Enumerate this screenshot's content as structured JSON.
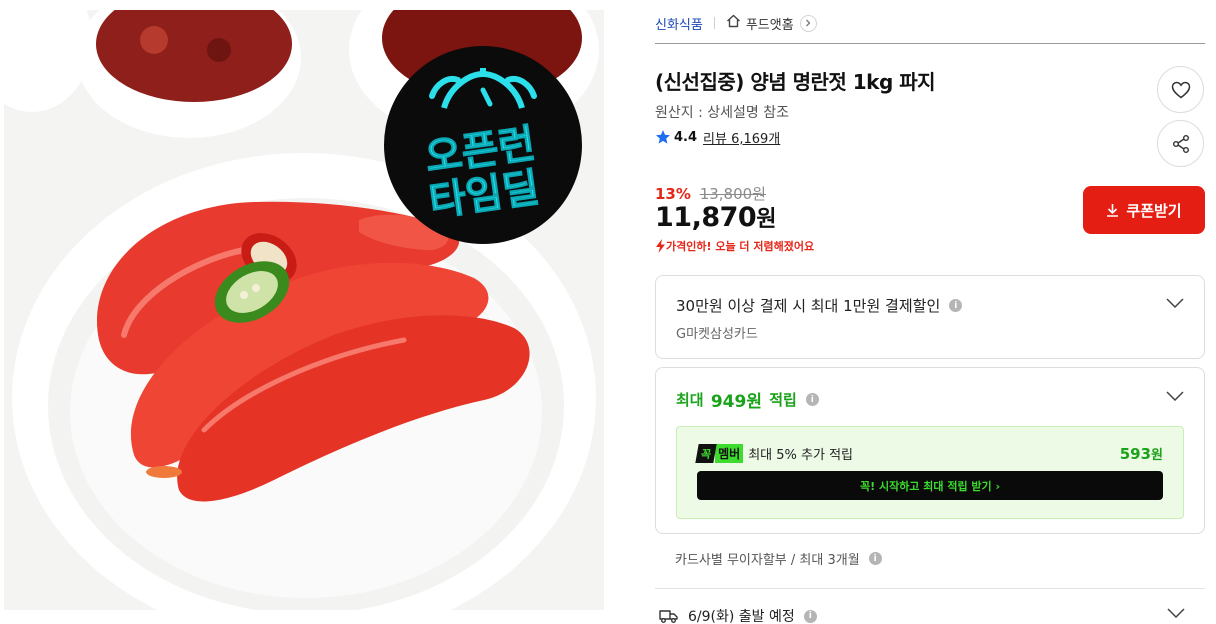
{
  "seller": {
    "name": "신화식품",
    "brand": "푸드앳홈"
  },
  "badge": {
    "line1": "오픈런",
    "line2": "타임딜"
  },
  "product": {
    "title": "(신선집중) 양념 명란젓 1kg 파지",
    "origin": "원산지 : 상세설명 참조",
    "rating": "4.4",
    "review_label": "리뷰 6,169개"
  },
  "price": {
    "discount_rate": "13%",
    "original": "13,800원",
    "sale_number": "11,870",
    "sale_unit": "원",
    "notice": "가격인하! 오늘 더 저렴해졌어요"
  },
  "coupon_button": "쿠폰받기",
  "card_benefit": {
    "title": "30만원 이상 결제 시 최대 1만원 결제할인",
    "subtitle": "G마켓삼성카드"
  },
  "reward": {
    "prefix": "최대",
    "amount": "949원",
    "suffix": "적립",
    "member_logo_a": "꼭",
    "member_logo_b": "멤버",
    "member_text": "최대 5% 추가 적립",
    "member_amount": "593",
    "member_amount_unit": "원",
    "cta": "꼭! 시작하고 최대 적립 받기  ›"
  },
  "installment": "카드사별 무이자할부 / 최대 3개월",
  "shipping": "6/9(화) 출발 예정",
  "icons": [
    "home-icon",
    "chevron-right-icon",
    "star-icon",
    "heart-icon",
    "share-icon",
    "download-icon",
    "bolt-icon",
    "info-icon",
    "chevron-down-icon",
    "truck-icon",
    "alarm-clock-icon"
  ],
  "colors": {
    "accent_red": "#e41e13",
    "reward_green": "#1aa31a",
    "member_green": "#3ddc2f",
    "link_blue": "#1a4ab8",
    "star_blue": "#1e6ef0"
  }
}
